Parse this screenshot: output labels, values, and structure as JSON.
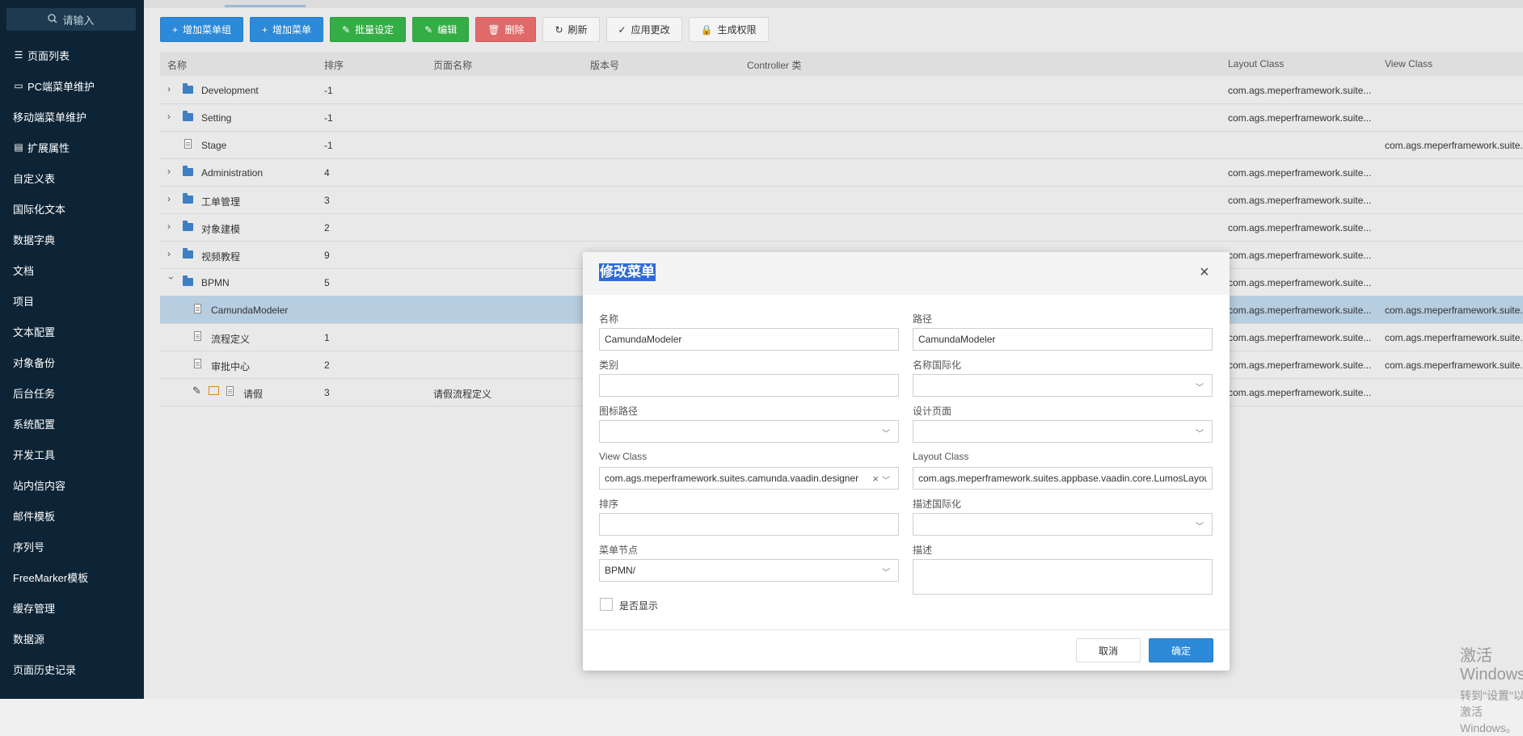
{
  "sidebar": {
    "search_placeholder": "请输入",
    "items": [
      {
        "label": "页面列表",
        "icon": "list-icon"
      },
      {
        "label": "PC端菜单维护",
        "icon": "monitor-icon"
      },
      {
        "label": "移动端菜单维护",
        "icon": ""
      },
      {
        "label": "扩展属性",
        "icon": "extension-icon"
      },
      {
        "label": "自定义表",
        "icon": ""
      },
      {
        "label": "国际化文本",
        "icon": ""
      },
      {
        "label": "数据字典",
        "icon": ""
      },
      {
        "label": "文档",
        "icon": ""
      },
      {
        "label": "项目",
        "icon": ""
      },
      {
        "label": "文本配置",
        "icon": ""
      },
      {
        "label": "对象备份",
        "icon": ""
      },
      {
        "label": "后台任务",
        "icon": ""
      },
      {
        "label": "系统配置",
        "icon": ""
      },
      {
        "label": "开发工具",
        "icon": ""
      },
      {
        "label": "站内信内容",
        "icon": ""
      },
      {
        "label": "邮件模板",
        "icon": ""
      },
      {
        "label": "序列号",
        "icon": ""
      },
      {
        "label": "FreeMarker模板",
        "icon": ""
      },
      {
        "label": "缓存管理",
        "icon": ""
      },
      {
        "label": "数据源",
        "icon": ""
      },
      {
        "label": "页面历史记录",
        "icon": ""
      }
    ]
  },
  "toolbar": {
    "add_group": "增加菜单组",
    "add_menu": "增加菜单",
    "batch": "批量设定",
    "edit": "编辑",
    "delete": "删除",
    "refresh": "刷新",
    "apply": "应用更改",
    "gen_perm": "生成权限"
  },
  "grid": {
    "headers": {
      "name": "名称",
      "order": "排序",
      "page_name": "页面名称",
      "version": "版本号",
      "controller": "Controller 类",
      "layout": "Layout Class",
      "view": "View Class"
    },
    "rows": [
      {
        "name": "Development",
        "order": "-1",
        "page": "",
        "layout": "com.ags.meperframework.suite...",
        "view": ""
      },
      {
        "name": "Setting",
        "order": "-1",
        "page": "",
        "layout": "com.ags.meperframework.suite...",
        "view": ""
      },
      {
        "name": "Stage",
        "order": "-1",
        "page": "",
        "layout": "",
        "view": "com.ags.meperframework.suite..."
      },
      {
        "name": "Administration",
        "order": "4",
        "page": "",
        "layout": "com.ags.meperframework.suite...",
        "view": ""
      },
      {
        "name": "工单管理",
        "order": "3",
        "page": "",
        "layout": "com.ags.meperframework.suite...",
        "view": ""
      },
      {
        "name": "对象建模",
        "order": "2",
        "page": "",
        "layout": "com.ags.meperframework.suite...",
        "view": ""
      },
      {
        "name": "视频教程",
        "order": "9",
        "page": "",
        "layout": "com.ags.meperframework.suite...",
        "view": ""
      },
      {
        "name": "BPMN",
        "order": "5",
        "page": "",
        "layout": "com.ags.meperframework.suite...",
        "view": ""
      },
      {
        "name": "CamundaModeler",
        "order": "",
        "page": "",
        "layout": "com.ags.meperframework.suite...",
        "view": "com.ags.meperframework.suite..."
      },
      {
        "name": "流程定义",
        "order": "1",
        "page": "",
        "layout": "com.ags.meperframework.suite...",
        "view": "com.ags.meperframework.suite..."
      },
      {
        "name": "审批中心",
        "order": "2",
        "page": "",
        "layout": "com.ags.meperframework.suite...",
        "view": "com.ags.meperframework.suite..."
      },
      {
        "name": "请假",
        "order": "3",
        "page": "请假流程定义",
        "layout": "com.ags.meperframework.suite...",
        "view": ""
      }
    ]
  },
  "dialog": {
    "title": "修改菜单",
    "name_label": "名称",
    "name_value": "CamundaModeler",
    "path_label": "路径",
    "path_value": "CamundaModeler",
    "type_label": "类别",
    "type_value": "",
    "name_i18n_label": "名称国际化",
    "name_i18n_value": "",
    "icon_path_label": "图标路径",
    "icon_path_value": "",
    "design_page_label": "设计页面",
    "design_page_value": "",
    "view_class_label": "View Class",
    "view_class_value": "com.ags.meperframework.suites.camunda.vaadin.designer",
    "layout_class_label": "Layout Class",
    "layout_class_value": "com.ags.meperframework.suites.appbase.vaadin.core.LumosLayout",
    "order_label": "排序",
    "order_value": "",
    "desc_i18n_label": "描述国际化",
    "desc_i18n_value": "",
    "menu_node_label": "菜单节点",
    "menu_node_value": "BPMN/",
    "desc_label": "描述",
    "desc_value": "",
    "show_label": "是否显示",
    "show_checked": false,
    "cancel": "取消",
    "ok": "确定"
  },
  "watermark": {
    "line1": "激活 Windows",
    "line2": "转到\"设置\"以激活 Windows。"
  },
  "colors": {
    "sidebar_bg": "#0d2436",
    "primary_blue": "#2d8ad8",
    "success_green": "#35ad46",
    "danger_red": "#e06a6a",
    "selected_row": "#b7cde0"
  }
}
